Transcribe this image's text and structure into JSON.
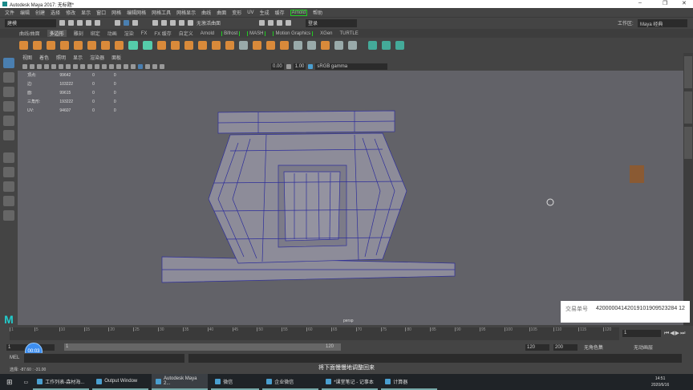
{
  "window": {
    "title": "Autodesk Maya 2017: 无标题*",
    "minimize": "–",
    "restore": "❐",
    "close": "✕"
  },
  "menu": [
    "文件",
    "编辑",
    "创建",
    "选择",
    "修改",
    "显示",
    "窗口",
    "网格",
    "编辑网格",
    "网格工具",
    "网格显示",
    "曲线",
    "曲面",
    "变形",
    "UV",
    "生成",
    "缓存",
    "Arnold",
    "帮助"
  ],
  "status": {
    "mode": "建模",
    "symmetry": "无激活曲面",
    "login": "登录",
    "workspace_label": "工作区:",
    "workspace": "Maya 经典"
  },
  "shelf_tabs": [
    "曲线/曲面",
    "多边形",
    "雕刻",
    "绑定",
    "动画",
    "渲染",
    "FX",
    "FX 缓存",
    "自定义",
    "Arnold",
    "Bifrost",
    "MASH",
    "Motion Graphics",
    "XGen",
    "TURTLE"
  ],
  "panel_menu": [
    "视图",
    "着色",
    "照明",
    "显示",
    "渲染器",
    "面板"
  ],
  "panel_toolbar": {
    "exposure": "0.00",
    "gamma": "1.00",
    "colorspace": "sRGB gamma"
  },
  "hud": [
    {
      "label": "顶点:",
      "v": "99642",
      "a": "0",
      "b": "0"
    },
    {
      "label": "边:",
      "v": "103222",
      "a": "0",
      "b": "0"
    },
    {
      "label": "面:",
      "v": "99615",
      "a": "0",
      "b": "0"
    },
    {
      "label": "三角形:",
      "v": "193222",
      "a": "0",
      "b": "0"
    },
    {
      "label": "UV:",
      "v": "94607",
      "a": "0",
      "b": "0"
    }
  ],
  "camera": "persp",
  "receipt": {
    "key": "交易单号",
    "value": "42000004142019101909523284 12"
  },
  "timeline": {
    "ticks": [
      "1",
      "5",
      "10",
      "15",
      "20",
      "25",
      "30",
      "35",
      "40",
      "45",
      "50",
      "55",
      "60",
      "65",
      "70",
      "75",
      "80",
      "85",
      "90",
      "95",
      "100",
      "105",
      "110",
      "115",
      "120"
    ],
    "current": "1"
  },
  "range": {
    "start": "1",
    "inner_start": "1",
    "inner_end": "120",
    "end": "120",
    "max": "200",
    "charset": "无角色集",
    "animlayer": "无动画层"
  },
  "cmd": {
    "label": "MEL"
  },
  "help": {
    "text": "选择: -87.60 : -31.00"
  },
  "timer": "00:03",
  "subtitle": "将下面慢慢地调整回来",
  "taskbar": {
    "items": [
      "工作列表-森材海...",
      "Output Window",
      "Autodesk Maya 2...",
      "微信",
      "企业微信",
      "*课堂笔记 - 记事本",
      "计算器"
    ],
    "time": "14:51",
    "date": "2020/6/16"
  }
}
